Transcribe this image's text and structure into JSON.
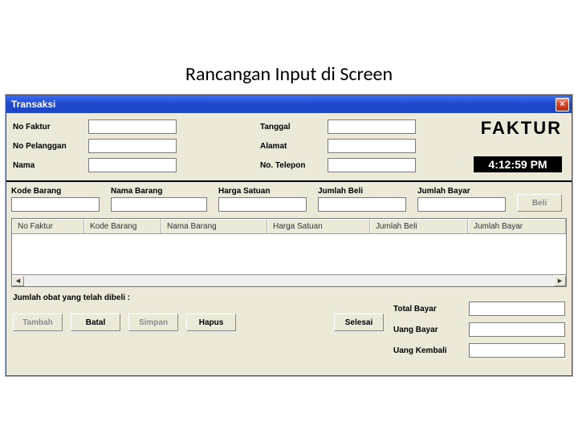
{
  "slide": {
    "title": "Rancangan Input di Screen"
  },
  "window": {
    "title": "Transaksi",
    "close": "×"
  },
  "form": {
    "no_faktur_label": "No Faktur",
    "no_faktur_value": "",
    "tanggal_label": "Tanggal",
    "tanggal_value": "",
    "no_pelanggan_label": "No Pelanggan",
    "no_pelanggan_value": "",
    "alamat_label": "Alamat",
    "alamat_value": "",
    "nama_label": "Nama",
    "nama_value": "",
    "telepon_label": "No. Telepon",
    "telepon_value": "",
    "faktur_big": "FAKTUR",
    "clock": "4:12:59 PM"
  },
  "item": {
    "kode_label": "Kode Barang",
    "kode_value": "",
    "nama_label": "Nama Barang",
    "nama_value": "",
    "harga_label": "Harga Satuan",
    "harga_value": "",
    "jumlah_label": "Jumlah Beli",
    "jumlah_value": "",
    "bayar_label": "Jumlah Bayar",
    "bayar_value": "",
    "beli_btn": "Beli"
  },
  "grid": {
    "headers": {
      "no_faktur": "No Faktur",
      "kode_barang": "Kode Barang",
      "nama_barang": "Nama Barang",
      "harga_satuan": "Harga Satuan",
      "jumlah_beli": "Jumlah Beli",
      "jumlah_bayar": "Jumlah Bayar"
    }
  },
  "summary": {
    "jumlah_obat_label": "Jumlah obat yang telah dibeli :",
    "tambah": "Tambah",
    "batal": "Batal",
    "simpan": "Simpan",
    "hapus": "Hapus",
    "selesai": "Selesai",
    "total_bayar_label": "Total Bayar",
    "total_bayar_value": "",
    "uang_bayar_label": "Uang Bayar",
    "uang_bayar_value": "",
    "uang_kembali_label": "Uang Kembali",
    "uang_kembali_value": ""
  }
}
